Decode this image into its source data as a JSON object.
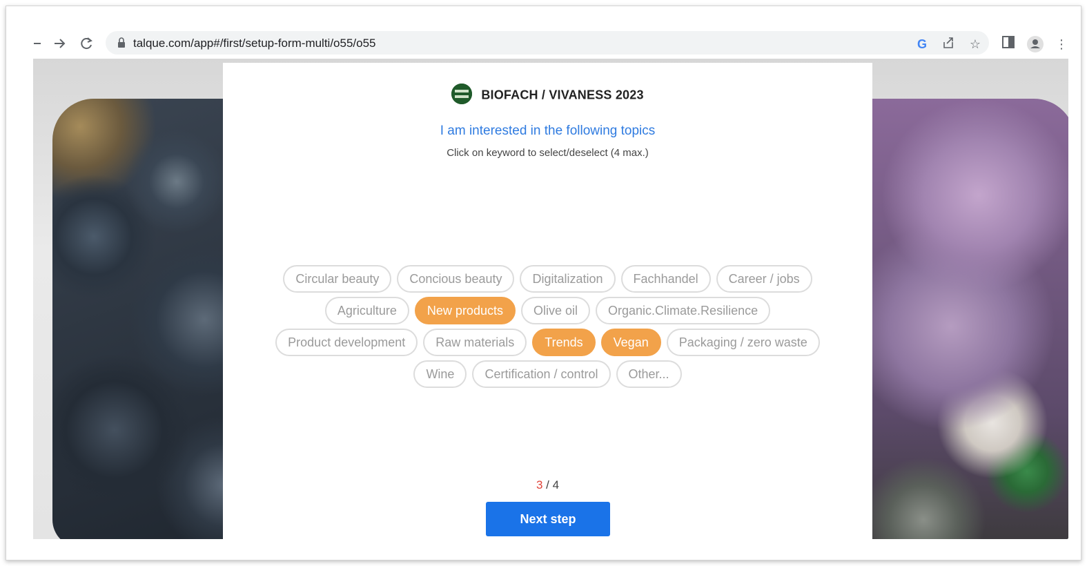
{
  "browser": {
    "url": "talque.com/app#/first/setup-form-multi/o55/o55",
    "icons": [
      "back-icon",
      "forward-icon",
      "reload-icon",
      "lock-icon",
      "google-icon",
      "share-icon",
      "star-icon",
      "side-panel-icon",
      "profile-icon",
      "menu-icon"
    ]
  },
  "event": {
    "title": "BIOFACH / VIVANESS 2023"
  },
  "form": {
    "heading": "I am interested in the following topics",
    "subheading": "Click on keyword to select/deselect (4 max.)",
    "topics": [
      {
        "label": "Circular beauty",
        "selected": false
      },
      {
        "label": "Concious beauty",
        "selected": false
      },
      {
        "label": "Digitalization",
        "selected": false
      },
      {
        "label": "Fachhandel",
        "selected": false
      },
      {
        "label": "Career / jobs",
        "selected": false
      },
      {
        "label": "Agriculture",
        "selected": false
      },
      {
        "label": "New products",
        "selected": true
      },
      {
        "label": "Olive oil",
        "selected": false
      },
      {
        "label": "Organic.Climate.Resilience",
        "selected": false
      },
      {
        "label": "Product development",
        "selected": false
      },
      {
        "label": "Raw materials",
        "selected": false
      },
      {
        "label": "Trends",
        "selected": true
      },
      {
        "label": "Vegan",
        "selected": true
      },
      {
        "label": "Packaging / zero waste",
        "selected": false
      },
      {
        "label": "Wine",
        "selected": false
      },
      {
        "label": "Certification / control",
        "selected": false
      },
      {
        "label": "Other...",
        "selected": false
      }
    ],
    "step_current": "3",
    "step_separator": " / ",
    "step_total": "4",
    "next_label": "Next step"
  },
  "colors": {
    "accent_blue": "#1a73e8",
    "selected_chip": "#f2a24a",
    "step_current": "#e0443a"
  }
}
